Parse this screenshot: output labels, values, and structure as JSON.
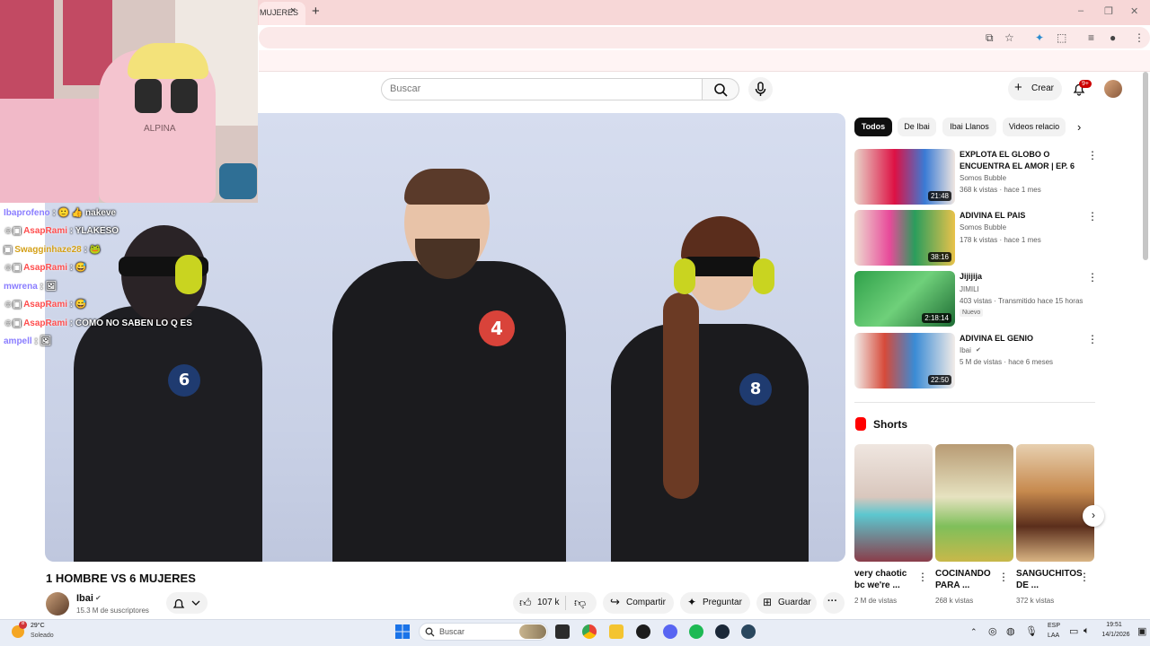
{
  "browser": {
    "tab_title": "MUJERES",
    "tab_close": "×",
    "new_tab": "+",
    "window_controls": [
      "–",
      "❐",
      "✕"
    ]
  },
  "header": {
    "search_placeholder": "Buscar",
    "create_label": "Crear",
    "notification_count": "9+"
  },
  "stream": {
    "chat": [
      {
        "user": "Ibaprofeno",
        "message": "nakeve",
        "user_color": "#8a7dff"
      },
      {
        "user": "AsapRami",
        "message": "YLAKESO",
        "user_color": "#ff4d4d"
      },
      {
        "user": "Swagginhaze28",
        "message": "",
        "user_color": "#d4a017"
      },
      {
        "user": "AsapRami",
        "message": "",
        "user_color": "#ff4d4d"
      },
      {
        "user": "mwrena",
        "message": "",
        "user_color": "#8a7dff"
      },
      {
        "user": "AsapRami",
        "message": "",
        "user_color": "#ff4d4d"
      },
      {
        "user": "AsapRami",
        "message": "COMO NO SABEN LO Q ES",
        "user_color": "#ff4d4d"
      },
      {
        "user": "ampell",
        "message": "",
        "user_color": "#8a7dff"
      }
    ],
    "chair_brand": "ALPINA"
  },
  "video": {
    "title": "1 HOMBRE VS 6 MUJERES",
    "numbers": [
      "6",
      "4",
      "8"
    ]
  },
  "channel": {
    "name": "Ibai",
    "subscribers": "15.3 M de suscriptores"
  },
  "actions": {
    "likes": "107 k",
    "share": "Compartir",
    "ask": "Preguntar",
    "save": "Guardar",
    "more": "···"
  },
  "chips": [
    "Todos",
    "De Ibai",
    "Ibai Llanos",
    "Videos relacio"
  ],
  "recommendations": [
    {
      "title": "EXPLOTA EL GLOBO O ENCUENTRA EL AMOR | EP. 6",
      "channel": "Somos Bubble",
      "meta": "368 k vistas · hace 1 mes",
      "duration": "21:48"
    },
    {
      "title": "ADIVINA EL PAIS",
      "channel": "Somos Bubble",
      "meta": "178 k vistas · hace 1 mes",
      "duration": "38:16"
    },
    {
      "title": "Jijijija",
      "channel": "JIMILI",
      "meta": "403 vistas · Transmitido hace 15 horas",
      "duration": "2:18:14",
      "badge": "Nuevo"
    },
    {
      "title": "ADIVINA EL GENIO",
      "channel": "Ibai",
      "meta": "5 M de vistas · hace 6 meses",
      "duration": "22:50"
    }
  ],
  "shorts": {
    "heading": "Shorts",
    "items": [
      {
        "title": "very chaotic bc we're ...",
        "views": "2 M de vistas"
      },
      {
        "title": "COCINANDO PARA ...",
        "views": "268 k vistas"
      },
      {
        "title": "SANGUCHITOS DE ...",
        "views": "372 k vistas"
      }
    ]
  },
  "taskbar": {
    "temperature": "29°C",
    "condition": "Soleado",
    "search_label": "Buscar",
    "lang_top": "ESP",
    "lang_bottom": "LAA",
    "time": "19:51",
    "date": "14/1/2026",
    "weather_badge": "8"
  }
}
